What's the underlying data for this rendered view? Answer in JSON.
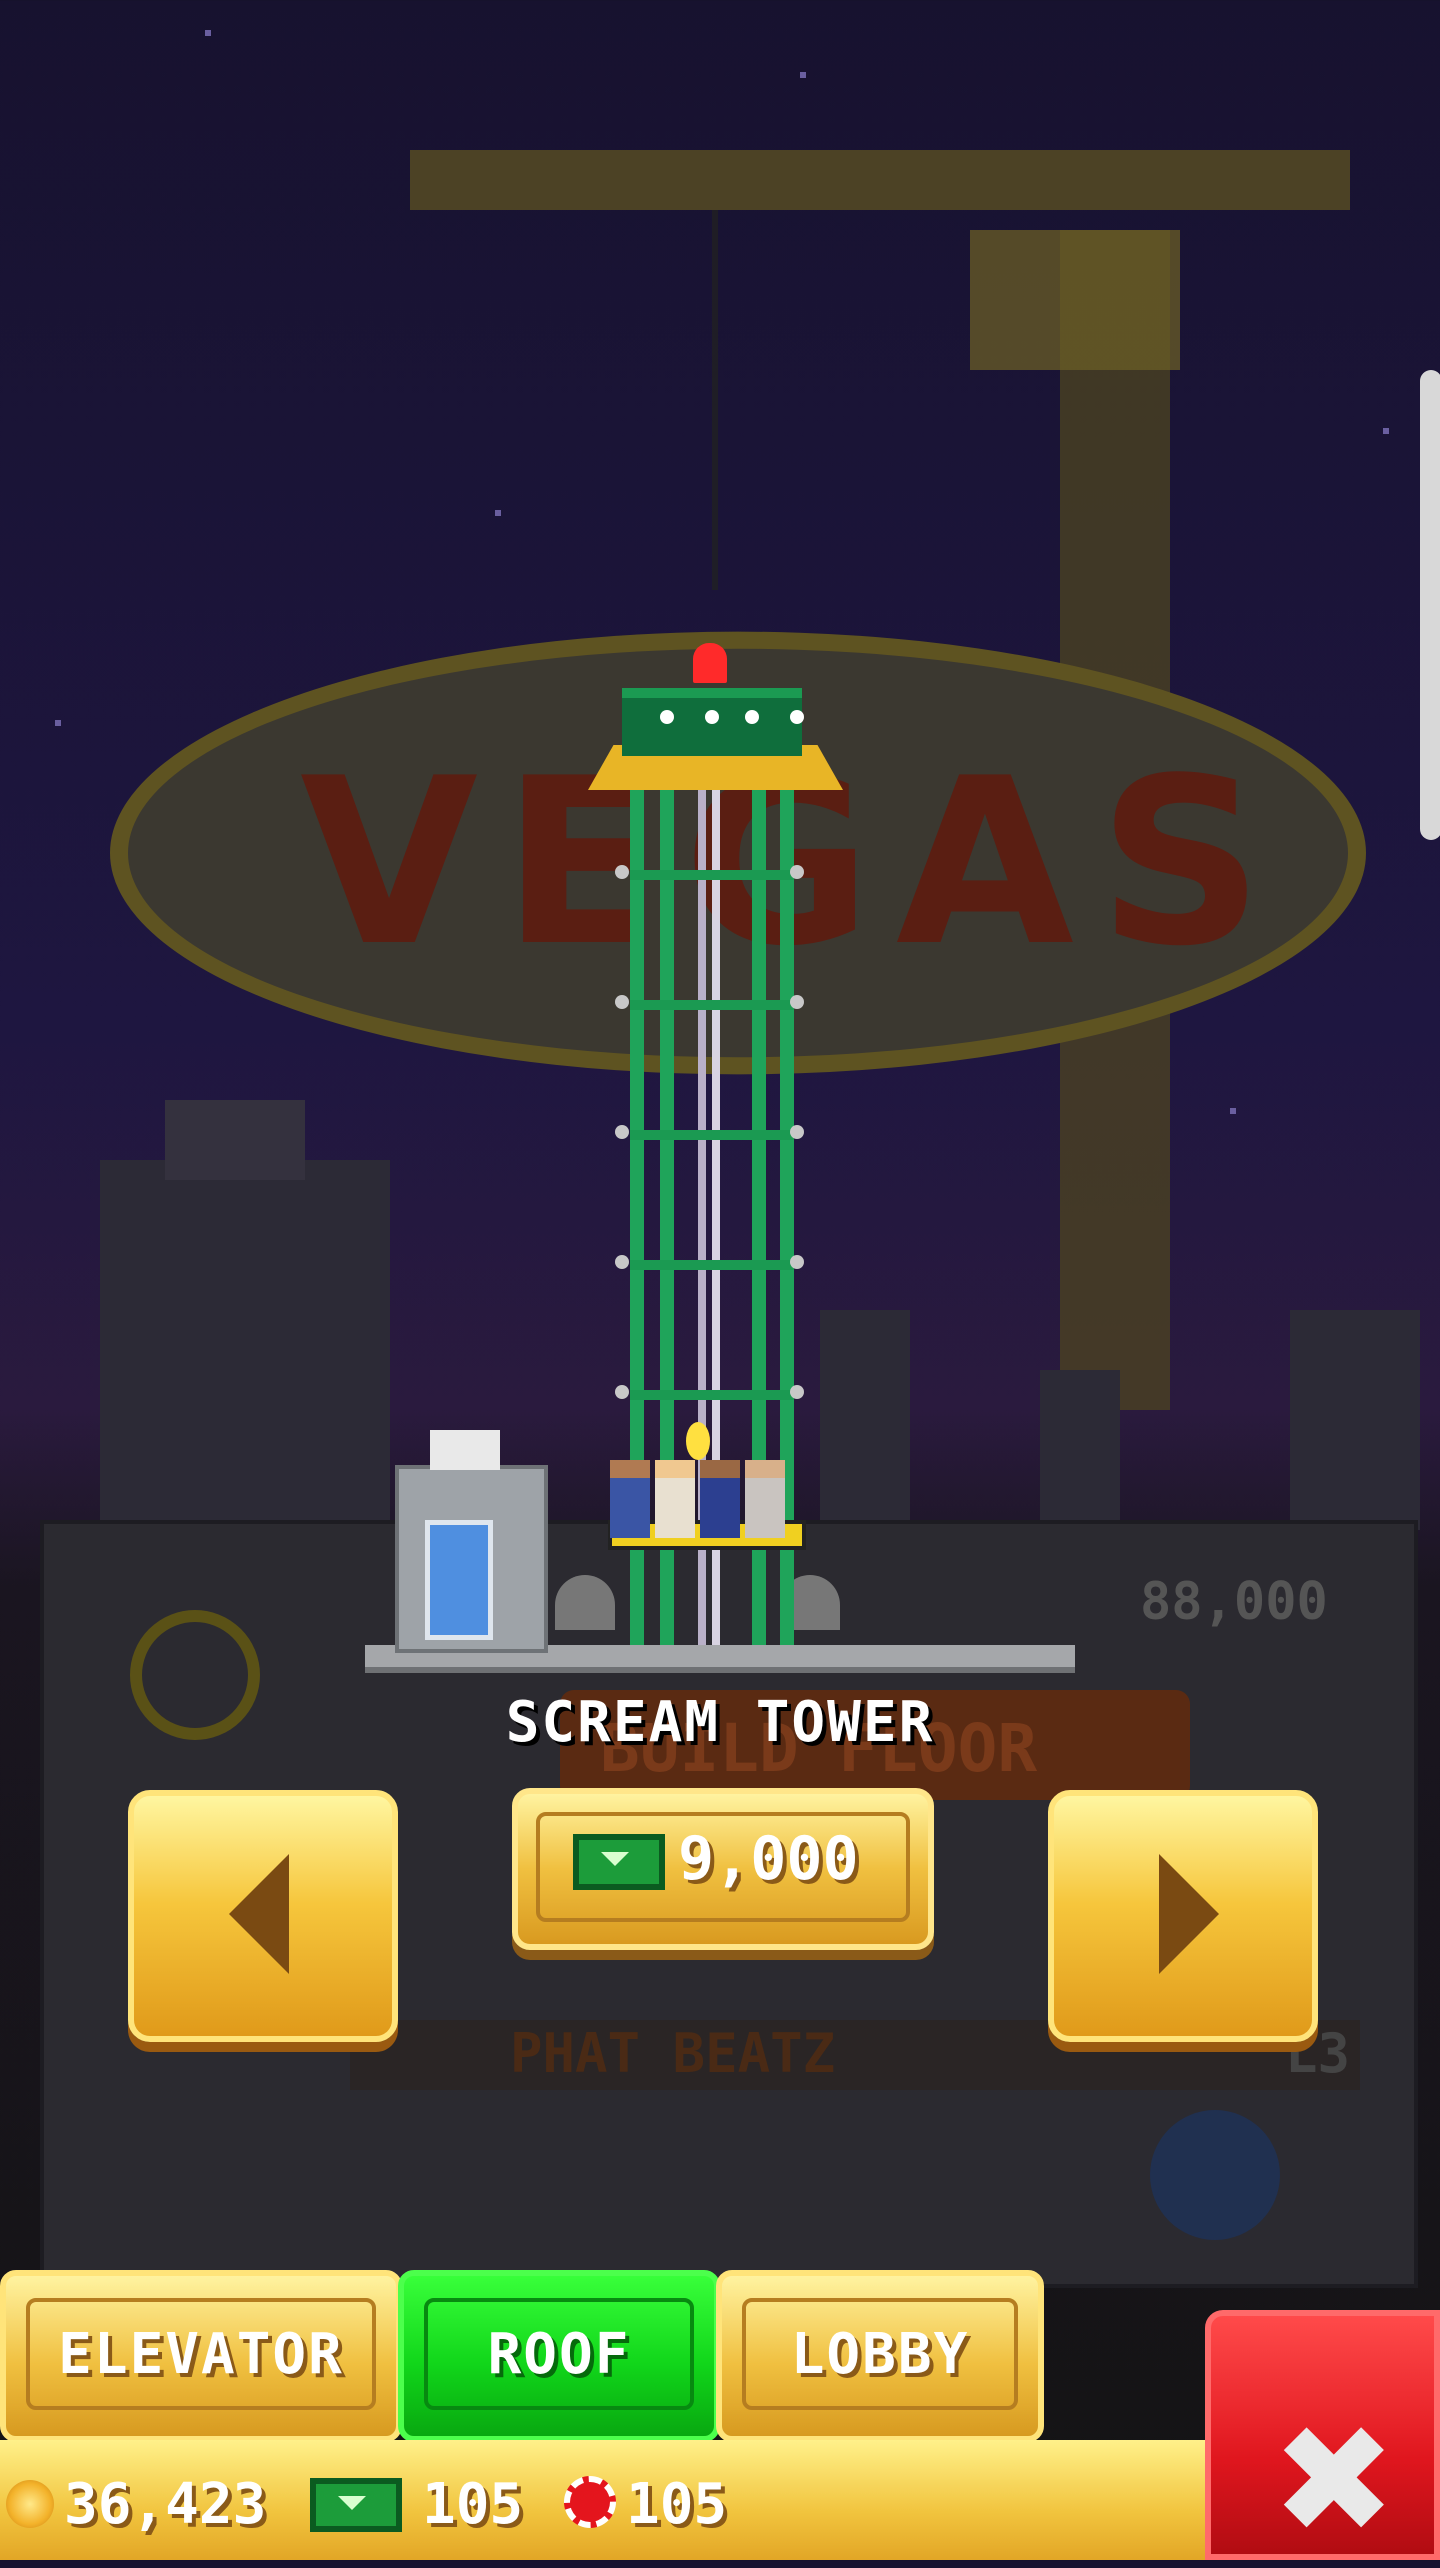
{
  "scene": {
    "sign_text": "VEGAS",
    "floor_price_label": "88,000",
    "floor_name": "PHAT BEATZ",
    "floor_level": "L3",
    "build_floor_text": "BUILD FLOOR"
  },
  "selector": {
    "title": "SCREAM TOWER",
    "price": "9,000",
    "price_icon": "cash-icon",
    "prev_icon": "arrow-left-icon",
    "next_icon": "arrow-right-icon"
  },
  "tabs": [
    {
      "label": "ELEVATOR",
      "active": false
    },
    {
      "label": "ROOF",
      "active": true
    },
    {
      "label": "LOBBY",
      "active": false
    }
  ],
  "status": {
    "coins": "36,423",
    "bux": "105",
    "chips": "105"
  },
  "colors": {
    "tower_green": "#1fa45a",
    "gold_button": "#f6c63c",
    "active_tab_green": "#11d61a",
    "close_red": "#e0161e"
  }
}
